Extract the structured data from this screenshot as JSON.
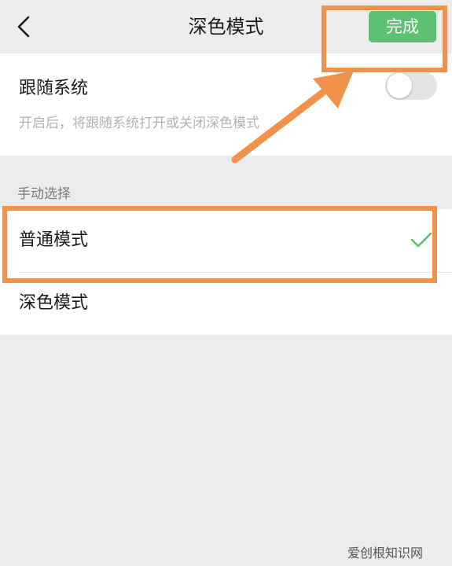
{
  "navbar": {
    "title": "深色模式",
    "back_icon": "chevron-left-icon",
    "done_label": "完成",
    "done_color": "#5dbf72"
  },
  "follow_system": {
    "title": "跟随系统",
    "description": "开启后，将跟随系统打开或关闭深色模式",
    "toggle_on": false
  },
  "manual": {
    "section_label": "手动选择",
    "options": [
      {
        "label": "普通模式",
        "selected": true
      },
      {
        "label": "深色模式",
        "selected": false
      }
    ],
    "check_icon": "checkmark-icon",
    "check_color": "#5dbf72"
  },
  "annotation": {
    "highlight_color": "#f0924a"
  },
  "watermark": "爱创根知识网"
}
